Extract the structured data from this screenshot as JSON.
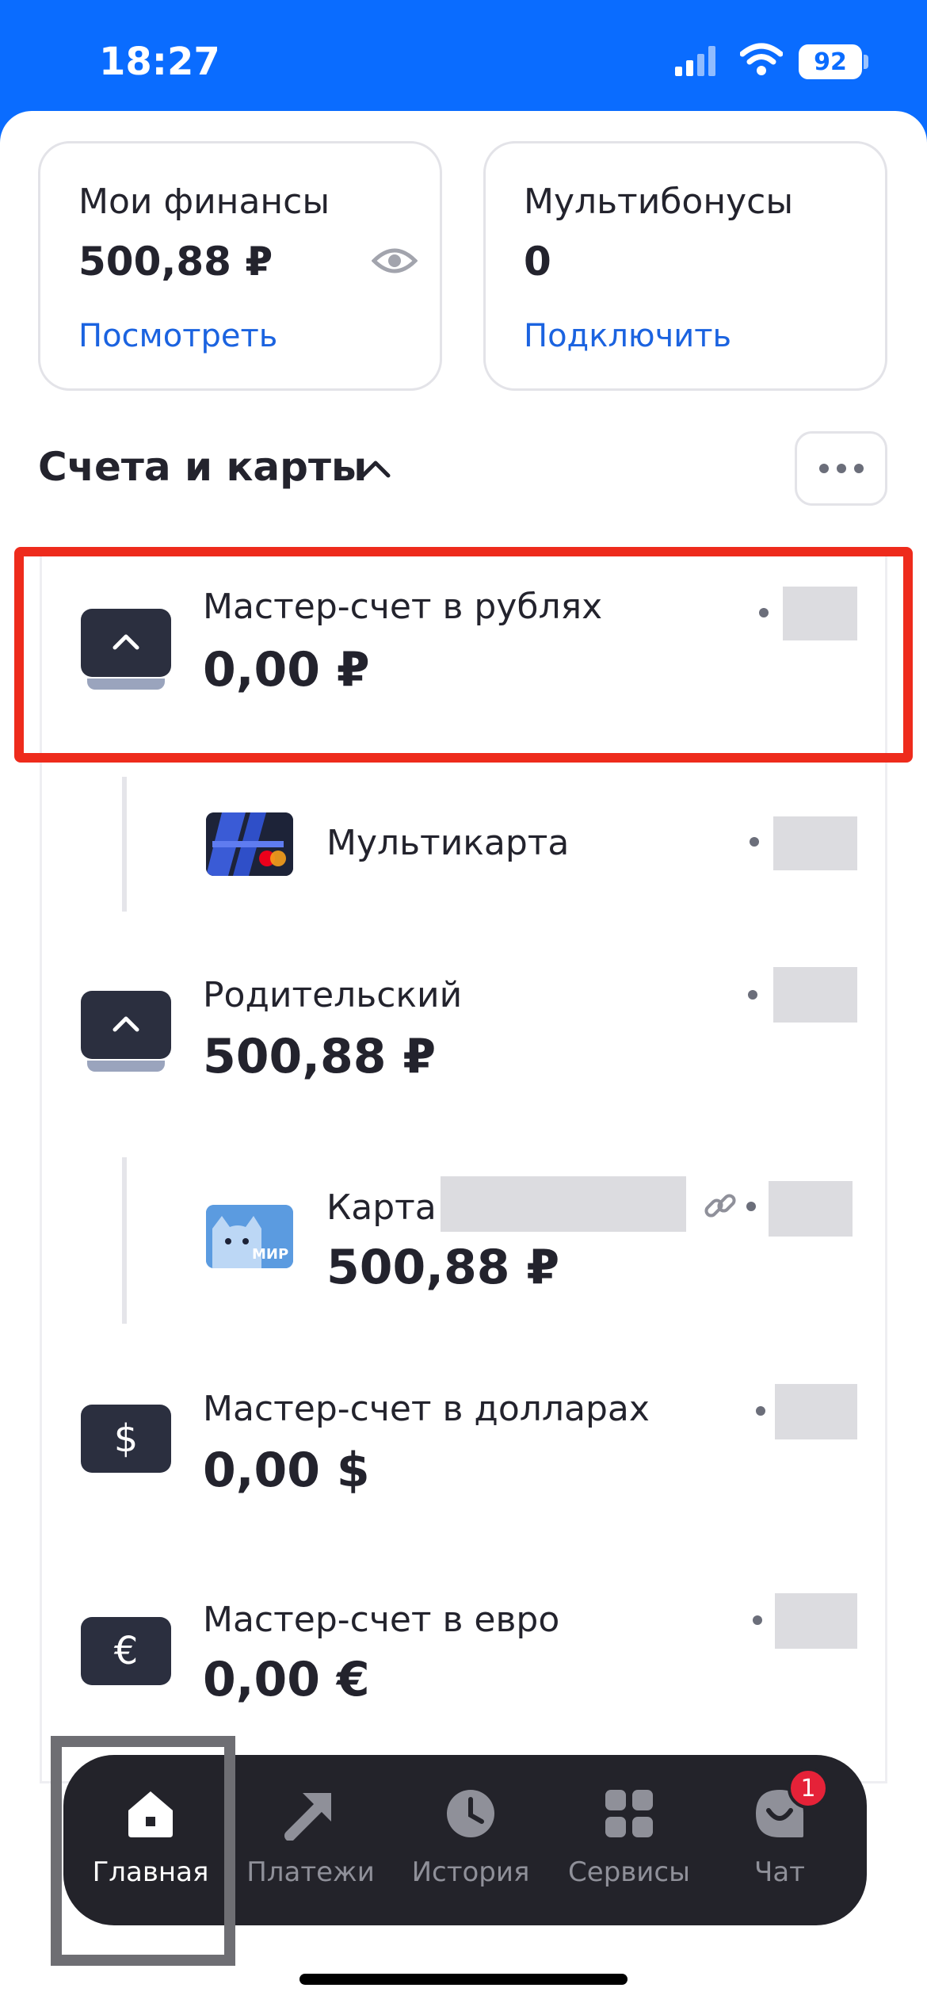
{
  "status_bar": {
    "time": "18:27",
    "battery": "92"
  },
  "summary": {
    "finances": {
      "title": "Мои финансы",
      "value": "500,88 ₽",
      "link": "Посмотреть"
    },
    "bonuses": {
      "title": "Мультибонусы",
      "value": "0",
      "link": "Подключить"
    }
  },
  "section": {
    "title": "Счета и карты"
  },
  "accounts": [
    {
      "name": "Мастер-счет в рублях",
      "amount": "0,00 ₽",
      "icon": "chevron-up-icon"
    },
    {
      "name": "Мультикарта",
      "icon": "card-icon"
    },
    {
      "name": "Родительский",
      "amount": "500,88 ₽",
      "icon": "chevron-up-icon"
    },
    {
      "name": "Карта",
      "amount": "500,88 ₽",
      "icon": "mir-card-icon"
    },
    {
      "name": "Мастер-счет в долларах",
      "amount": "0,00 $",
      "icon_symbol": "$"
    },
    {
      "name": "Мастер-счет в евро",
      "amount": "0,00 €",
      "icon_symbol": "€"
    }
  ],
  "tabbar": {
    "tabs": [
      {
        "label": "Главная",
        "icon": "home-icon",
        "active": true
      },
      {
        "label": "Платежи",
        "icon": "arrow-icon"
      },
      {
        "label": "История",
        "icon": "clock-icon"
      },
      {
        "label": "Сервисы",
        "icon": "grid-icon"
      },
      {
        "label": "Чат",
        "icon": "chat-icon",
        "badge": "1"
      }
    ]
  },
  "colors": {
    "brand": "#0a6cff",
    "highlight": "#ee2b1c",
    "link": "#1b63e0"
  }
}
